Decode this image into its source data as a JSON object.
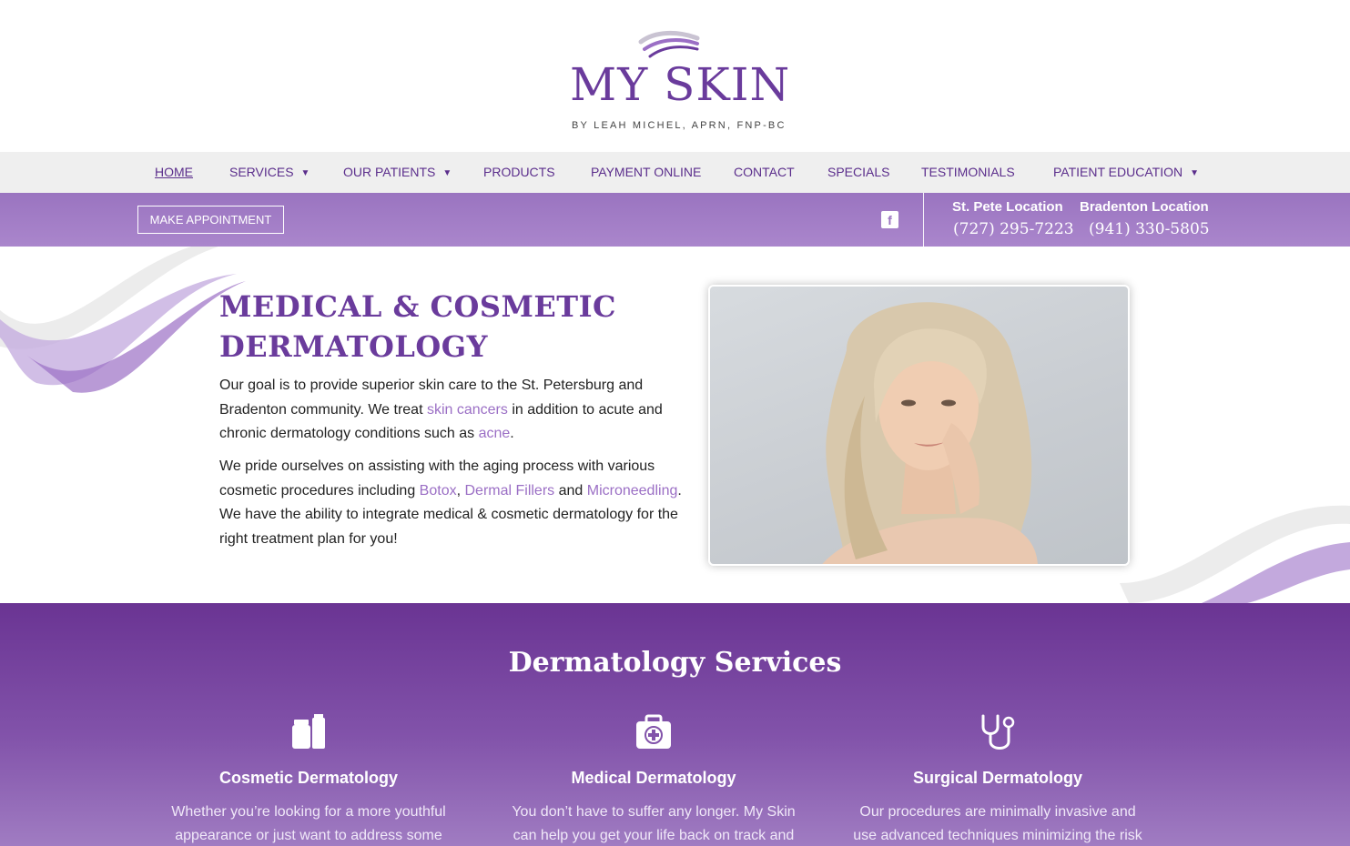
{
  "brand": {
    "logo_text": "MY SKIN",
    "logo_subtitle": "BY LEAH MICHEL, APRN, FNP-BC",
    "primary_color": "#6a3b9c",
    "accent_color": "#9b6fc5"
  },
  "nav": {
    "items": [
      {
        "label": "HOME",
        "active": true
      },
      {
        "label": "SERVICES",
        "dropdown": true
      },
      {
        "label": "OUR PATIENTS",
        "dropdown": true
      },
      {
        "label": "PRODUCTS"
      },
      {
        "label": "PAYMENT ONLINE"
      },
      {
        "label": "CONTACT"
      },
      {
        "label": "SPECIALS"
      },
      {
        "label": "TESTIMONIALS"
      },
      {
        "label": "PATIENT EDUCATION",
        "dropdown": true
      }
    ]
  },
  "topbar": {
    "appointment_label": "MAKE APPOINTMENT",
    "facebook_icon": "facebook-icon",
    "locations": [
      {
        "name": "St. Pete Location",
        "phone": "(727) 295-7223"
      },
      {
        "name": "Bradenton Location",
        "phone": "(941) 330-5805"
      }
    ]
  },
  "hero": {
    "title_line1": "MEDICAL & COSMETIC",
    "title_line2": "DERMATOLOGY",
    "p1": {
      "a": "Our goal is to provide superior skin care to the St. Petersburg and Bradenton community. We treat ",
      "link1": "skin cancers",
      "b": " in addition to acute and chronic dermatology conditions such as ",
      "link2": "acne",
      "c": "."
    },
    "p2": {
      "a": "We pride ourselves on assisting with the aging process with various cosmetic procedures including ",
      "link1": "Botox",
      "b": ", ",
      "link2": "Dermal Fillers",
      "c": " and ",
      "link3": "Microneedling",
      "d": ". We have the ability to integrate medical & cosmetic dermatology for the right treatment plan for you!"
    },
    "image_icon": "woman-portrait-photo"
  },
  "services": {
    "title": "Dermatology Services",
    "items": [
      {
        "icon": "cosmetic-jars-icon",
        "name": "Cosmetic Dermatology",
        "desc": "Whether you’re looking for a more youthful appearance or just want to address some"
      },
      {
        "icon": "medical-kit-icon",
        "name": "Medical Dermatology",
        "desc": "You don’t have to suffer any longer. My Skin can help you get your life back on track and achieve"
      },
      {
        "icon": "stethoscope-icon",
        "name": "Surgical Dermatology",
        "desc": "Our procedures are minimally invasive and use advanced techniques minimizing the risk of"
      }
    ]
  }
}
